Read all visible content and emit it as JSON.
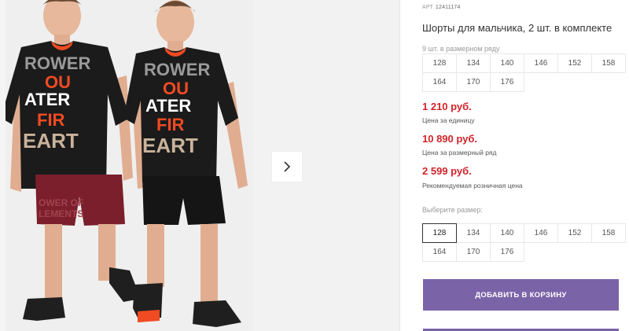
{
  "product": {
    "sku_label": "АРТ",
    "sku": "12411174",
    "title": "Шорты для мальчика, 2 шт. в комплекте"
  },
  "size_range": {
    "caption": "9 шт. в размерном ряду",
    "sizes": [
      "128",
      "134",
      "140",
      "146",
      "152",
      "158",
      "164",
      "170",
      "176"
    ]
  },
  "prices": [
    {
      "value": "1 210 руб.",
      "label": "Цена за единицу"
    },
    {
      "value": "10 890 руб.",
      "label": "Цена за размерный ряд"
    },
    {
      "value": "2 599 руб.",
      "label": "Рекомендуемая розничная цена"
    }
  ],
  "size_select": {
    "caption": "Выберите размер:",
    "selected": "128",
    "sizes": [
      "128",
      "134",
      "140",
      "146",
      "152",
      "158",
      "164",
      "170",
      "176"
    ]
  },
  "actions": {
    "add_to_cart": "ДОБАВИТЬ В КОРЗИНУ"
  },
  "gallery": {
    "next_icon": "chevron-right-icon",
    "tshirt_print_lines": [
      "ROWER",
      "OU",
      "ATER",
      "FIR",
      "EART"
    ],
    "shorts_print_lines": [
      "OWER OF",
      "LEMENTS"
    ]
  },
  "colors": {
    "accent": "#7b63a8",
    "price": "#d2232a",
    "tshirt": "#1b1b1b",
    "shorts_left": "#7a1f2b",
    "shorts_right": "#151515",
    "print_orange": "#f04b23",
    "print_beige": "#c9b39a"
  }
}
